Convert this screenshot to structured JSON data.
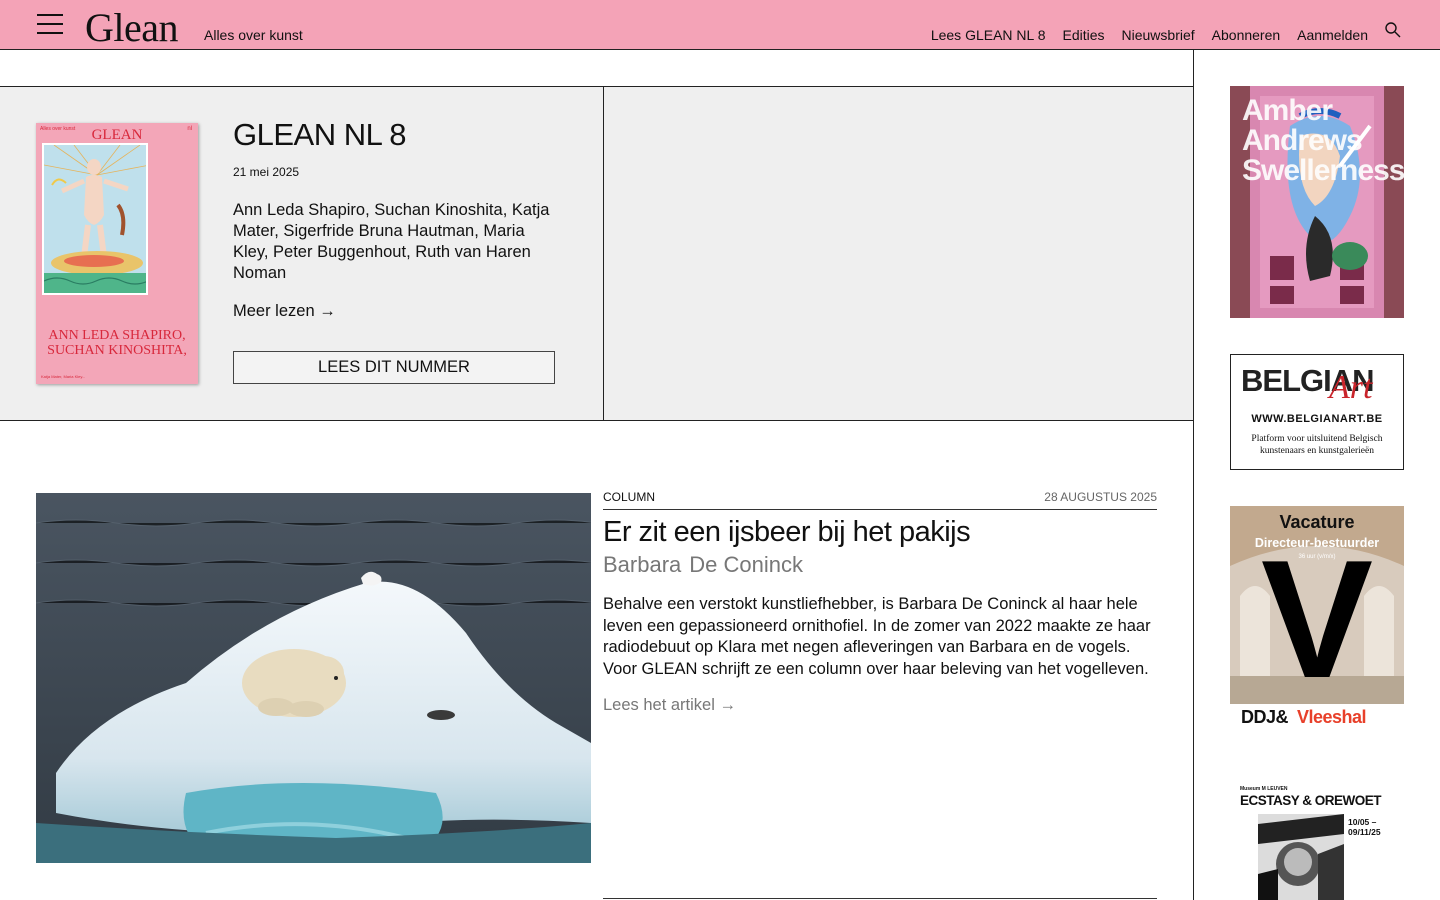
{
  "header": {
    "logo": "Glean",
    "tagline": "Alles over kunst",
    "nav": [
      "Lees GLEAN NL 8",
      "Edities",
      "Nieuwsbrief",
      "Abonneren",
      "Aanmelden"
    ],
    "icons": [
      "hamburger-menu-icon",
      "search-icon"
    ],
    "background_color": "#f4a3b7"
  },
  "issue": {
    "title": "GLEAN NL 8",
    "date": "21 mei 2025",
    "authors": "Ann Leda Shapiro, Suchan Kinoshita, Katja Mater, Sigerfride Bruna Hautman, Maria Kley, Peter Buggenhout, Ruth van Haren Noman",
    "more": "Meer lezen →",
    "button": "LEES DIT NUMMER",
    "cover": {
      "title": "GLEAN",
      "names": "ANN LEDA SHAPIRO, SUCHAN KINOSHITA,"
    }
  },
  "article": {
    "category": "COLUMN",
    "date": "28 AUGUSTUS 2025",
    "title": "Er zit een ijsbeer bij het pakijs",
    "author_first": "Barbara",
    "author_last": "De Coninck",
    "excerpt": "Behalve een verstokt kunstliefhebber, is Barbara De Coninck al haar hele leven een gepassioneerd ornithofiel. In de zomer van 2022 maakte ze haar radiodebuut op Klara met negen afleveringen van Barbara en de vogels. Voor GLEAN schrijft ze een column over haar beleving van het vogelleven.",
    "read_more": "Lees het artikel →"
  },
  "ads": {
    "ad1": {
      "text": "Amber Andrews Swellerness"
    },
    "ad2": {
      "logo": "BELGIAN",
      "logo_script": "Art",
      "url": "WWW.BELGIANART.BE",
      "tagline": "Platform voor uitsluitend Belgisch kunstenaars en kunstgalerieën"
    },
    "ad3": {
      "title": "Vacature",
      "subtitle": "Directeur-bestuurder",
      "hours": "36 uur (v/m/x)",
      "letter": "V",
      "brand1": "DDJ&",
      "brand2": "Vleeshal"
    },
    "ad4": {
      "museum": "Museum M LEUVEN",
      "title": "ECSTASY & OREWOET",
      "dates": "10/05 – 09/11/25"
    }
  }
}
